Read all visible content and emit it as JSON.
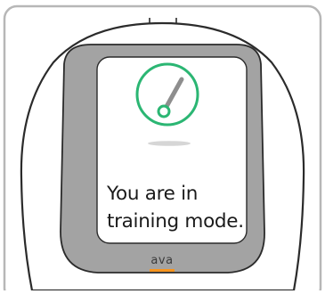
{
  "device": {
    "screen_message_line1": "You are in",
    "screen_message_line2": "training mode.",
    "brand_logo_text": "ava"
  },
  "colors": {
    "frame_border": "#b7b7b7",
    "device_body": "#ffffff",
    "device_outline": "#2b2b2b",
    "bezel": "#a3a3a3",
    "screen": "#ffffff",
    "side_button": "#4a4a4a",
    "ring_accent": "#2bb673",
    "needle": "#8e8e8e",
    "shadow": "#d6d6d6",
    "brand_underline": "#f7941d"
  },
  "icons": {
    "status_icon": "training-gauge-icon"
  }
}
